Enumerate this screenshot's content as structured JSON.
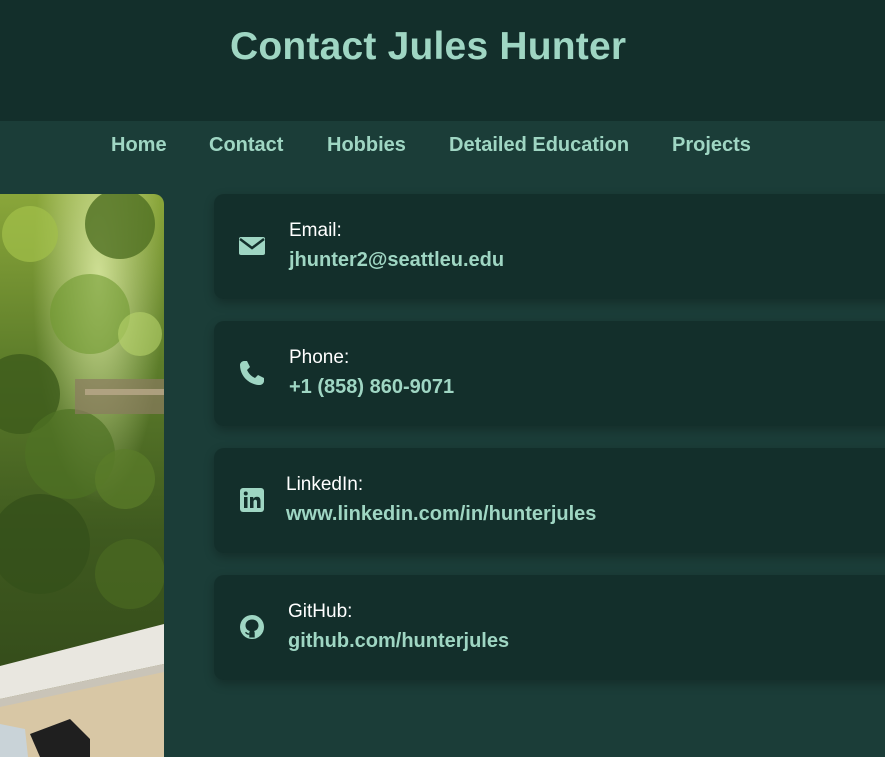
{
  "header": {
    "title": "Contact Jules Hunter"
  },
  "nav": {
    "items": [
      {
        "label": "Home"
      },
      {
        "label": "Contact"
      },
      {
        "label": "Hobbies"
      },
      {
        "label": "Detailed Education"
      },
      {
        "label": "Projects"
      }
    ]
  },
  "contacts": [
    {
      "label": "Email:",
      "value": "jhunter2@seattleu.edu",
      "icon": "envelope-icon"
    },
    {
      "label": "Phone:",
      "value": "+1 (858) 860-9071",
      "icon": "phone-icon"
    },
    {
      "label": "LinkedIn:",
      "value": "www.linkedin.com/in/hunterjules",
      "icon": "linkedin-icon"
    },
    {
      "label": "GitHub:",
      "value": "github.com/hunterjules",
      "icon": "github-icon"
    }
  ],
  "colors": {
    "header_bg": "#132f2b",
    "page_bg": "#1b3d38",
    "accent": "#9fd6c3",
    "card_bg": "#132f2b"
  }
}
